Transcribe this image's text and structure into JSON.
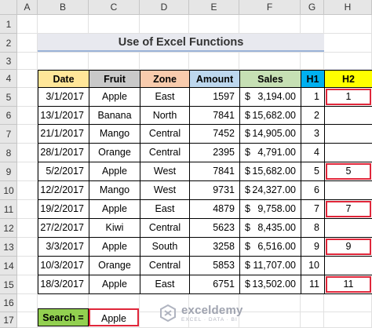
{
  "column_headers": [
    "A",
    "B",
    "C",
    "D",
    "E",
    "F",
    "G",
    "H"
  ],
  "row_numbers": [
    "1",
    "2",
    "3",
    "4",
    "5",
    "6",
    "7",
    "8",
    "9",
    "10",
    "11",
    "12",
    "13",
    "14",
    "15",
    "16",
    "17"
  ],
  "title": "Use of Excel Functions",
  "table": {
    "headers": [
      "Date",
      "Fruit",
      "Zone",
      "Amount",
      "Sales",
      "H1",
      "H2"
    ],
    "header_colors": [
      "#ffe699",
      "#c9c9c9",
      "#f8cbad",
      "#bdd7ee",
      "#c6e0b4",
      "#00b0f0",
      "#ffff00"
    ],
    "rows": [
      {
        "date": "3/1/2017",
        "fruit": "Apple",
        "zone": "East",
        "amount": "1597",
        "sales": "3,194.00",
        "h1": "1",
        "h2": "1"
      },
      {
        "date": "13/1/2017",
        "fruit": "Banana",
        "zone": "North",
        "amount": "7841",
        "sales": "15,682.00",
        "h1": "2",
        "h2": ""
      },
      {
        "date": "21/1/2017",
        "fruit": "Mango",
        "zone": "Central",
        "amount": "7452",
        "sales": "14,905.00",
        "h1": "3",
        "h2": ""
      },
      {
        "date": "28/1/2017",
        "fruit": "Orange",
        "zone": "Central",
        "amount": "2395",
        "sales": "4,791.00",
        "h1": "4",
        "h2": ""
      },
      {
        "date": "5/2/2017",
        "fruit": "Apple",
        "zone": "West",
        "amount": "7841",
        "sales": "15,682.00",
        "h1": "5",
        "h2": "5"
      },
      {
        "date": "12/2/2017",
        "fruit": "Mango",
        "zone": "West",
        "amount": "9731",
        "sales": "24,327.00",
        "h1": "6",
        "h2": ""
      },
      {
        "date": "19/2/2017",
        "fruit": "Apple",
        "zone": "East",
        "amount": "4879",
        "sales": "9,758.00",
        "h1": "7",
        "h2": "7"
      },
      {
        "date": "27/2/2017",
        "fruit": "Kiwi",
        "zone": "Central",
        "amount": "5623",
        "sales": "8,435.00",
        "h1": "8",
        "h2": ""
      },
      {
        "date": "3/3/2017",
        "fruit": "Apple",
        "zone": "South",
        "amount": "3258",
        "sales": "6,516.00",
        "h1": "9",
        "h2": "9"
      },
      {
        "date": "10/3/2017",
        "fruit": "Orange",
        "zone": "Central",
        "amount": "5853",
        "sales": "11,707.00",
        "h1": "10",
        "h2": ""
      },
      {
        "date": "18/3/2017",
        "fruit": "Apple",
        "zone": "East",
        "amount": "6751",
        "sales": "13,502.00",
        "h1": "11",
        "h2": "11"
      }
    ],
    "currency_symbol": "$"
  },
  "search": {
    "label": "Search =",
    "value": "Apple"
  },
  "watermark": {
    "name": "exceldemy",
    "tagline": "EXCEL · DATA · BI"
  },
  "colors": {
    "highlight_border": "#e0263a",
    "search_label_bg": "#92d050",
    "title_bg": "#e8e9ef"
  }
}
